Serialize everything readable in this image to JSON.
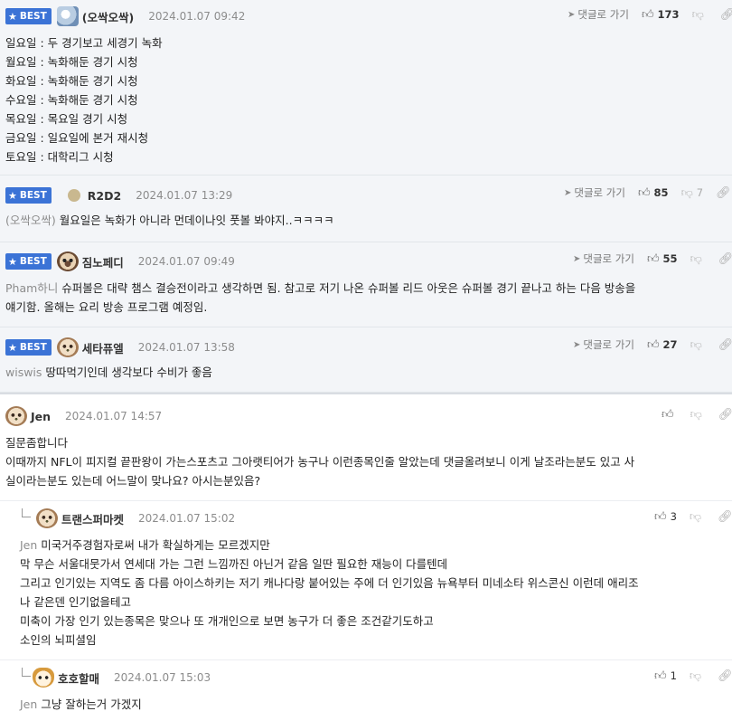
{
  "labels": {
    "best": "BEST",
    "reply_link": "댓글로 가기"
  },
  "comments": [
    {
      "best": true,
      "nick": "(오싹오싹)",
      "date": "2024.01.07 09:42",
      "likes": "173",
      "dislikes": "",
      "lines": [
        "일요일 : 두 경기보고 세경기 녹화",
        "월요일 : 녹화해둔 경기 시청",
        "화요일 : 녹화해둔 경기 시청",
        "수요일 : 녹화해둔 경기 시청",
        "목요일 : 목요일 경기 시청",
        "금요일 : 일요일에 본거 재시청",
        "토요일 : 대학리그 시청"
      ]
    },
    {
      "best": true,
      "nick": "R2D2",
      "date": "2024.01.07 13:29",
      "likes": "85",
      "dislikes": "7",
      "mention": "(오싹오싹)",
      "text": "월요일은 녹화가 아니라 먼데이나잇 풋볼 봐야지..ㅋㅋㅋㅋ"
    },
    {
      "best": true,
      "nick": "짐노페디",
      "date": "2024.01.07 09:49",
      "likes": "55",
      "dislikes": "",
      "mention": "Pham하니",
      "text": "슈퍼볼은 대략 챔스 결승전이라고 생각하면 됨. 참고로 저기 나온 슈퍼볼 리드 아웃은 슈퍼볼 경기 끝나고 하는 다음 방송을",
      "text2": "얘기함. 올해는 요리 방송 프로그램 예정임."
    },
    {
      "best": true,
      "nick": "세타퓨엘",
      "date": "2024.01.07 13:58",
      "likes": "27",
      "dislikes": "",
      "mention": "wiswis",
      "text": "땅따먹기인데 생각보다 수비가 좋음"
    },
    {
      "best": false,
      "nick": "Jen",
      "date": "2024.01.07 14:57",
      "likes": "",
      "dislikes": "",
      "lines": [
        "질문좀합니다",
        "이때까지 NFL이 피지컬 끝판왕이 가는스포츠고 그아랫티어가 농구나 이런종목인줄 알았는데 댓글올려보니 이게 날조라는분도 있고 사",
        "실이라는분도 있는데 어느말이 맞나요? 아시는분있음?"
      ]
    },
    {
      "best": false,
      "reply": true,
      "nick": "트랜스퍼마켓",
      "date": "2024.01.07 15:02",
      "likes": "3",
      "dislikes": "",
      "mention": "Jen",
      "text": "미국거주경험자로써 내가 확실하게는 모르겠지만",
      "lines": [
        "막 무슨 서울대뭇가서 연세대 가는 그런 느낌까진 아닌거 같음 일딴 필요한 재능이 다를텐데",
        "그리고 인기있는 지역도 좀 다름 아이스하키는 저기 캐나다랑 붙어있는 주에 더 인기있음 뉴욕부터 미네소타 위스콘신 이런데 애리조",
        "나 같은덴 인기없을테고",
        "미축이 가장 인기 있는종목은 맞으나 또 개개인으로 보면 농구가 더 좋은 조건같기도하고",
        "소인의 뇌피셜임"
      ]
    },
    {
      "best": false,
      "reply": true,
      "nick": "호호할매",
      "date": "2024.01.07 15:03",
      "likes": "1",
      "dislikes": "",
      "mention": "Jen",
      "text": "그냥 잘하는거 가겠지"
    }
  ],
  "icons": {
    "reply_arrow": "send-arrow-icon",
    "like": "thumbs-up-icon",
    "dislike": "thumbs-down-icon",
    "link": "link-icon"
  },
  "colors": {
    "best_badge": "#3b73d6",
    "best_bg": "#f3f5f8"
  }
}
